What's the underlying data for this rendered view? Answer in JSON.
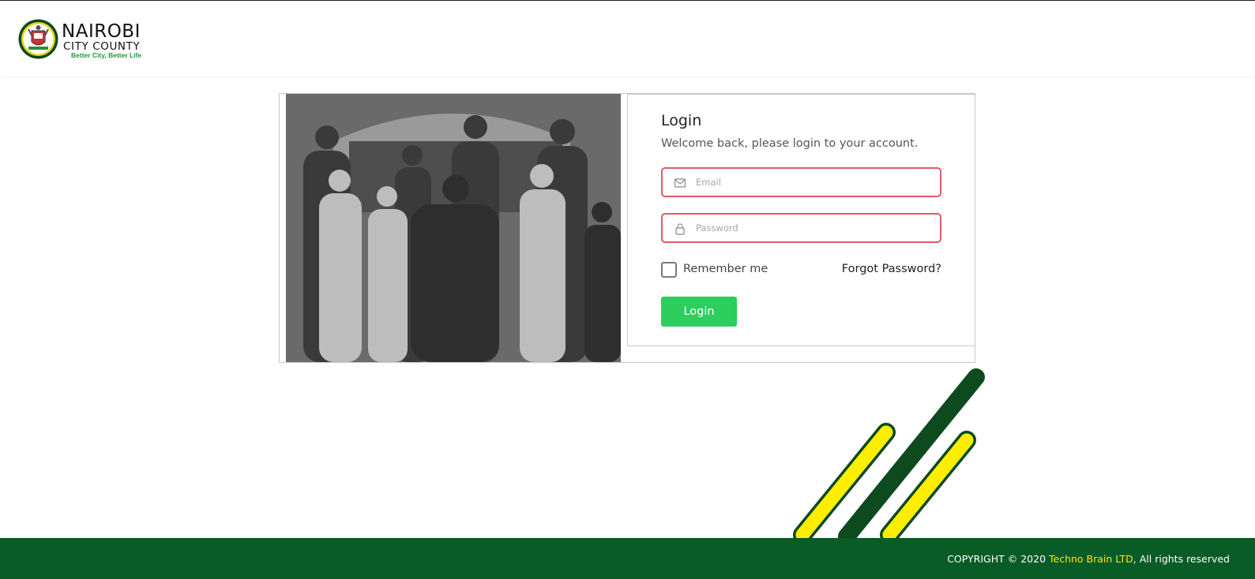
{
  "header": {
    "logo": {
      "name": "NAIROBI",
      "sub": "CITY COUNTY",
      "tagline": "Better City, Better Life"
    }
  },
  "login": {
    "title": "Login",
    "subtitle": "Welcome back, please login to your account.",
    "email_placeholder": "Email",
    "password_placeholder": "Password",
    "remember_label": "Remember me",
    "forgot_label": "Forgot Password?",
    "button_label": "Login"
  },
  "footer": {
    "copyright_prefix": "COPYRIGHT © 2020 ",
    "company": "Techno Brain LTD",
    "copyright_suffix": ", All rights reserved"
  },
  "colors": {
    "brand_green": "#0a5c27",
    "button_green": "#2dce5e",
    "stripe_yellow": "#ffee00",
    "stripe_dark_green": "#0d4a1e",
    "input_error_border": "#e25a66",
    "company_link": "#f5e616"
  },
  "icons": {
    "email_field": "envelope-icon",
    "password_field": "lock-icon"
  }
}
